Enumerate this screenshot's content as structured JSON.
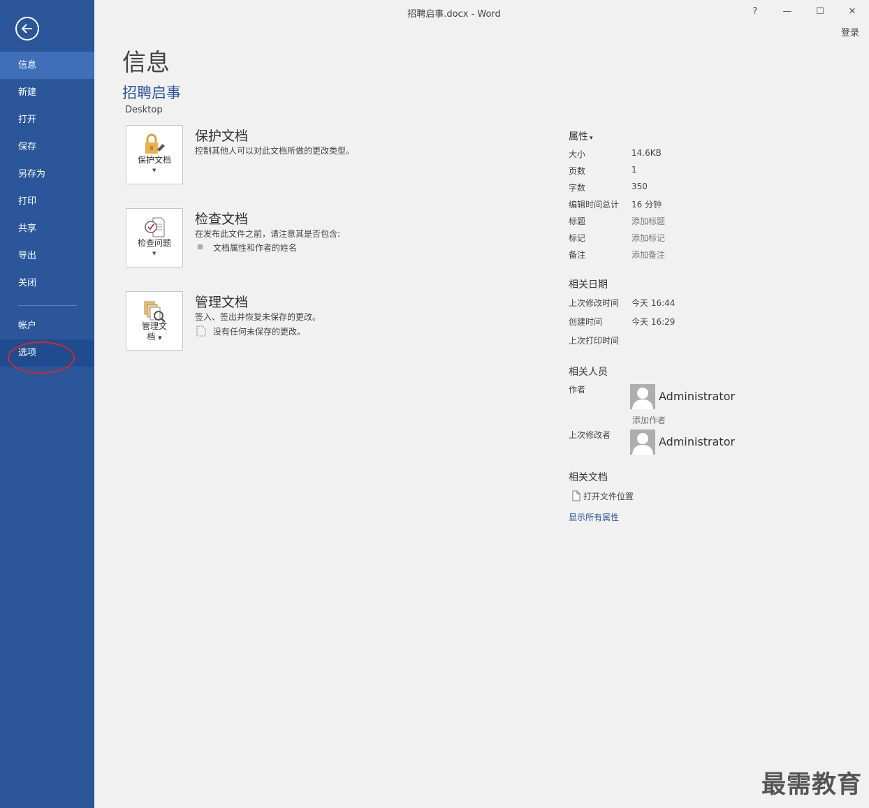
{
  "window": {
    "title": "招聘启事.docx - Word",
    "help": "?",
    "minimize": "—",
    "maximize": "☐",
    "close": "✕",
    "signin": "登录"
  },
  "sidebar": {
    "items": [
      "信息",
      "新建",
      "打开",
      "保存",
      "另存为",
      "打印",
      "共享",
      "导出",
      "关闭"
    ],
    "lower_items": [
      "帐户",
      "选项"
    ],
    "active": "信息",
    "highlight_color": "#d5262a"
  },
  "main": {
    "page_title": "信息",
    "doc_name": "招聘启事",
    "doc_location": "Desktop",
    "sections": [
      {
        "tile_label_1": "保护文档",
        "tile_label_2": "",
        "title": "保护文档",
        "description": "控制其他人可以对此文档所做的更改类型。",
        "bullet": ""
      },
      {
        "tile_label_1": "检查问题",
        "tile_label_2": "",
        "title": "检查文档",
        "description": "在发布此文件之前，请注意其是否包含:",
        "bullet": "文档属性和作者的姓名"
      },
      {
        "tile_label_1": "管理文",
        "tile_label_2": "档",
        "title": "管理文档",
        "description": "签入、签出并恢复未保存的更改。",
        "bullet": "没有任何未保存的更改。"
      }
    ]
  },
  "properties": {
    "heading": "属性",
    "dropdown_glyph": "▾",
    "rows": [
      {
        "label": "大小",
        "value": "14.6KB"
      },
      {
        "label": "页数",
        "value": "1"
      },
      {
        "label": "字数",
        "value": "350"
      },
      {
        "label": "编辑时间总计",
        "value": "16 分钟"
      },
      {
        "label": "标题",
        "value": "添加标题"
      },
      {
        "label": "标记",
        "value": "添加标记"
      },
      {
        "label": "备注",
        "value": "添加备注"
      }
    ],
    "dates_heading": "相关日期",
    "dates": [
      {
        "label": "上次修改时间",
        "value": "今天 16:44"
      },
      {
        "label": "创建时间",
        "value": "今天 16:29"
      },
      {
        "label": "上次打印时间",
        "value": ""
      }
    ],
    "people_heading": "相关人员",
    "author_label": "作者",
    "author_name": "Administrator",
    "add_author": "添加作者",
    "last_modified_by_label": "上次修改者",
    "last_modified_by_name": "Administrator",
    "docs_heading": "相关文档",
    "open_location": "打开文件位置",
    "show_all": "显示所有属性"
  },
  "watermark": "最需教育",
  "colors": {
    "sidebar": "#2b579a",
    "sidebar_active": "#3f6fb8",
    "accent": "#2b579a"
  }
}
